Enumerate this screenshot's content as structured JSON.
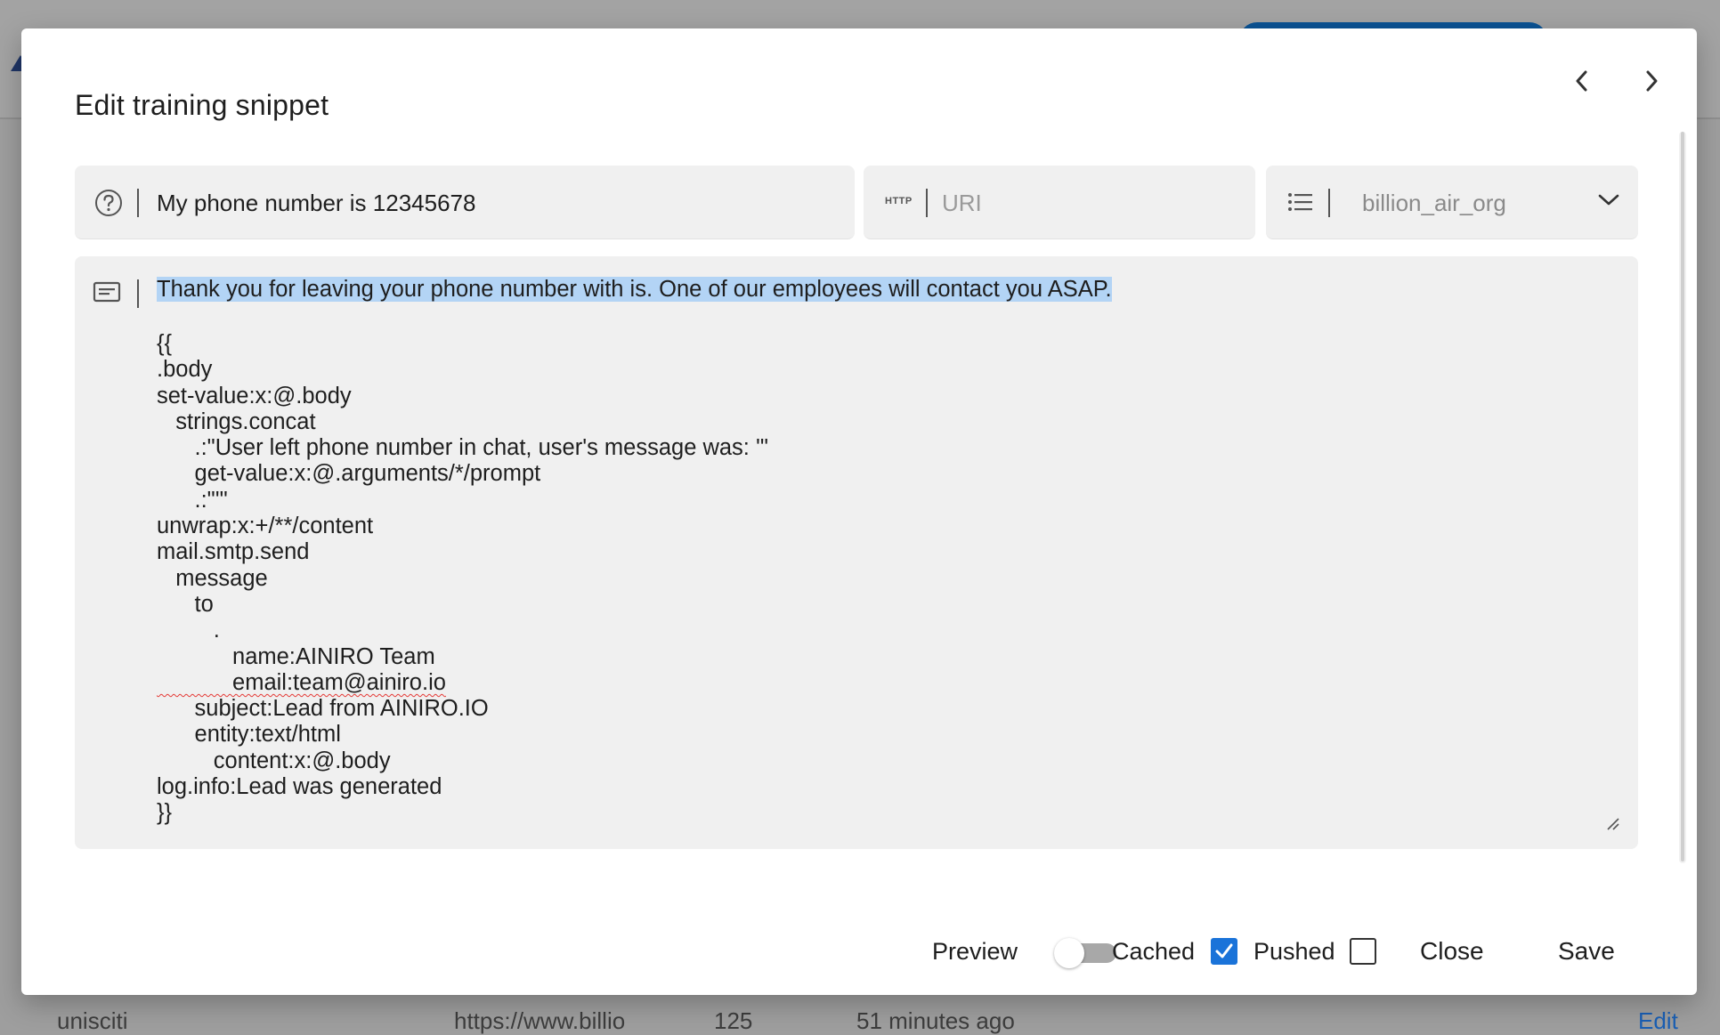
{
  "background": {
    "row_cells": [
      "unisciti",
      "https://www.billio",
      "125",
      "51 minutes ago",
      "Edit"
    ],
    "accent_color": "#0b5394"
  },
  "dialog": {
    "title": "Edit training snippet",
    "prev_icon": "chevron-left-icon",
    "next_icon": "chevron-right-icon"
  },
  "fields": {
    "prompt": {
      "icon": "help-circle-icon",
      "value": "My phone number is 12345678"
    },
    "uri": {
      "icon": "http-icon",
      "icon_text": "HTTP",
      "placeholder": "URI",
      "value": ""
    },
    "type": {
      "icon": "list-icon",
      "selected": "billion_air_org",
      "dropdown_icon": "chevron-down-icon"
    }
  },
  "content": {
    "icon": "message-icon",
    "first_line": "Thank you for leaving your phone number with is. One of our employees will contact you ASAP.",
    "code_lines": [
      "{{",
      ".body",
      "set-value:x:@.body",
      "   strings.concat",
      "      .:\"User left phone number in chat, user's message was: '\"",
      "      get-value:x:@.arguments/*/prompt",
      "      .:\"'\"",
      "unwrap:x:+/**/content",
      "mail.smtp.send",
      "   message",
      "      to",
      "         .",
      "            name:AINIRO Team",
      "            email:team@ainiro.io",
      "      subject:Lead from AINIRO.IO",
      "      entity:text/html",
      "         content:x:@.body",
      "log.info:Lead was generated",
      "}}"
    ],
    "highlight_color": "#b3d4f5"
  },
  "footer": {
    "preview_label": "Preview",
    "preview_on": false,
    "cached_label": "Cached",
    "cached_checked": true,
    "pushed_label": "Pushed",
    "pushed_checked": false,
    "close_label": "Close",
    "save_label": "Save",
    "check_color": "#1a73d9"
  }
}
